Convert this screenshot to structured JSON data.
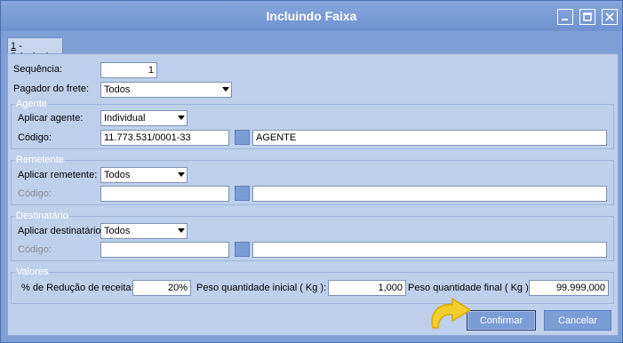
{
  "window": {
    "title": "Incluindo Faixa",
    "controls": [
      "minimize-icon",
      "maximize-icon",
      "close-icon"
    ]
  },
  "tab": {
    "mnemonic": "1",
    "label": " - Principal"
  },
  "form": {
    "sequencia": {
      "label": "Sequência:",
      "value": "1"
    },
    "pagador": {
      "label": "Pagador do frete:",
      "value": "Todos"
    }
  },
  "agente": {
    "legend": "Agente",
    "aplicar_label": "Aplicar agente:",
    "aplicar_value": "Individual",
    "codigo_label": "Código:",
    "codigo_value": "11.773.531/0001-33",
    "nome_value": "AGENTE"
  },
  "remetente": {
    "legend": "Remetente",
    "aplicar_label": "Aplicar remetente:",
    "aplicar_value": "Todos",
    "codigo_label": "Código:",
    "codigo_value": "",
    "nome_value": ""
  },
  "destinatario": {
    "legend": "Destinatário",
    "aplicar_label": "Aplicar destinatário:",
    "aplicar_value": "Todos",
    "codigo_label": "Código:",
    "codigo_value": "",
    "nome_value": ""
  },
  "valores": {
    "legend": "Valores",
    "reducao_label": "% de Redução de receita:",
    "reducao_value": "20%",
    "peso_inicial_label": "Peso quantidade inicial ( Kg ):",
    "peso_inicial_value": "1,000",
    "peso_final_label": "Peso quantidade final ( Kg ):",
    "peso_final_value": "99.999,000"
  },
  "buttons": {
    "confirmar": "Confirmar",
    "cancelar": "Cancelar"
  },
  "colors": {
    "window_bg": "#7ea0d6",
    "panel_bg": "#bfd0ec",
    "button_bg": "#7b9dd6",
    "cursor": "#f2cf2a"
  }
}
